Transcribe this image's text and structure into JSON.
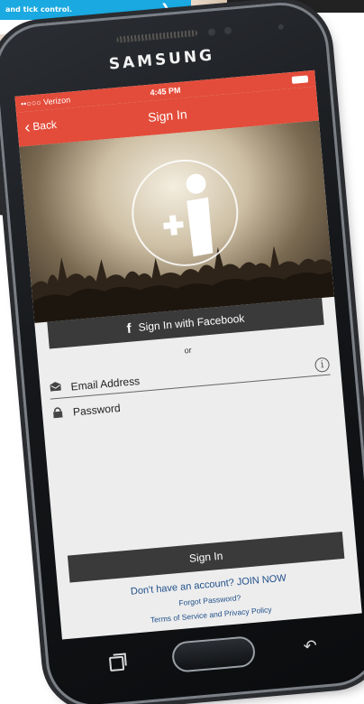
{
  "background": {
    "card_text": "and tick control.",
    "arrow_icon": "chevron-right-icon"
  },
  "device": {
    "brand": "SAMSUNG"
  },
  "status_bar": {
    "carrier": "••○○○ Verizon",
    "time": "4:45 PM"
  },
  "nav": {
    "back_label": "Back",
    "title": "Sign In"
  },
  "facebook_button": {
    "label": "Sign In with Facebook",
    "icon": "f"
  },
  "or_text": "or",
  "form": {
    "email_placeholder": "Email Address",
    "password_placeholder": "Password"
  },
  "signin_button": {
    "label": "Sign In"
  },
  "links": {
    "join": "Don't have an account? JOIN NOW",
    "forgot": "Forgot Password?",
    "terms": "Terms of Service and Privacy Policy"
  },
  "colors": {
    "accent": "#e34c3a",
    "button_dark": "#3a3a3a",
    "link_blue": "#1f4f8a"
  }
}
